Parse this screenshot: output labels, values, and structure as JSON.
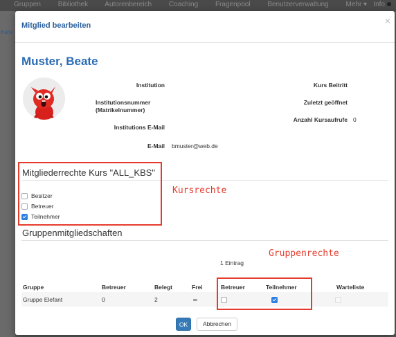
{
  "background": {
    "nav_items": [
      "Gruppen",
      "Bibliothek",
      "Autorenbereich",
      "Coaching",
      "Fragenpool",
      "Benutzerverwaltung",
      "Mehr ▾"
    ],
    "nav_right": "Info",
    "crumb": "Kurs"
  },
  "modal": {
    "title": "Mitglied bearbeiten",
    "close": "×"
  },
  "member": {
    "name": "Muster, Beate",
    "avatar_icon": "red-monster-avatar"
  },
  "info": {
    "institution_label": "Institution",
    "institution_value": "",
    "inst_number_label_1": "Institutionsnummer",
    "inst_number_label_2": "(Matrikelnummer)",
    "inst_number_value": "",
    "inst_email_label": "Institutions E-Mail",
    "inst_email_value": "",
    "email_label": "E-Mail",
    "email_value": "bmuster@web.de",
    "course_join_label": "Kurs Beitritt",
    "course_join_value": "",
    "last_opened_label": "Zuletzt geöffnet",
    "last_opened_value": "",
    "course_visits_label": "Anzahl Kursaufrufe",
    "course_visits_value": "0"
  },
  "rights": {
    "title": "Mitgliederrechte Kurs \"ALL_KBS\"",
    "annotation": "Kursrechte",
    "options": [
      {
        "label": "Besitzer",
        "checked": false
      },
      {
        "label": "Betreuer",
        "checked": false
      },
      {
        "label": "Teilnehmer",
        "checked": true
      }
    ]
  },
  "groups": {
    "title": "Gruppenmitgliedschaften",
    "annotation": "Gruppenrechte",
    "entries": "1 Eintrag",
    "columns": [
      "Gruppe",
      "Betreuer",
      "Belegt",
      "Frei",
      "Betreuer",
      "Teilnehmer",
      "Warteliste"
    ],
    "rows": [
      {
        "gruppe": "Gruppe Elefant",
        "betreuer": "0",
        "belegt": "2",
        "frei": "∞",
        "cb_betreuer": false,
        "cb_teilnehmer": true,
        "cb_warteliste": false
      }
    ]
  },
  "buttons": {
    "ok": "OK",
    "cancel": "Abbrechen"
  },
  "colors": {
    "accent": "#337ab7",
    "annotation": "#e53b2c",
    "title_blue": "#2a5f9e"
  }
}
